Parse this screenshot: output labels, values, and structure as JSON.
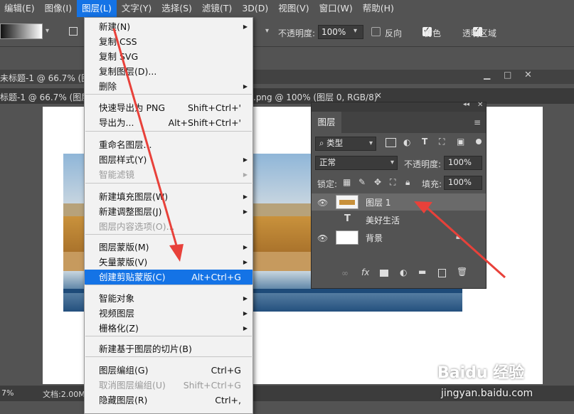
{
  "menubar": {
    "items": [
      "编辑(E)",
      "图像(I)",
      "图层(L)",
      "文字(Y)",
      "选择(S)",
      "滤镜(T)",
      "3D(D)",
      "视图(V)",
      "窗口(W)",
      "帮助(H)"
    ],
    "active_index": 2
  },
  "options_bar": {
    "opacity_label": "不透明度:",
    "opacity_value": "100%",
    "reverse_label": "反向",
    "dither_label": "仿色",
    "transparency_label": "透明区域"
  },
  "documents": {
    "window_title": "未标题-1 @ 66.7% (图层 1, RGB/8)",
    "tab_title": "标题-1 @ 66.7% (图层",
    "tab_second": ".png @ 100% (图层 0, RGB/8)",
    "tab_close": "×"
  },
  "status": {
    "zoom": "7%",
    "doc_info": "文档:2.00M"
  },
  "dropdown": {
    "items": [
      {
        "label": "新建(N)",
        "shortcut": "",
        "submenu": true,
        "disabled": false
      },
      {
        "label": "复制 CSS",
        "shortcut": "",
        "submenu": false,
        "disabled": false
      },
      {
        "label": "复制 SVG",
        "shortcut": "",
        "submenu": false,
        "disabled": false
      },
      {
        "label": "复制图层(D)...",
        "shortcut": "",
        "submenu": false,
        "disabled": false
      },
      {
        "label": "删除",
        "shortcut": "",
        "submenu": true,
        "disabled": false
      },
      {
        "label": "快速导出为 PNG",
        "shortcut": "Shift+Ctrl+'",
        "submenu": false,
        "disabled": false
      },
      {
        "label": "导出为...",
        "shortcut": "Alt+Shift+Ctrl+'",
        "submenu": false,
        "disabled": false
      },
      {
        "label": "重命名图层...",
        "shortcut": "",
        "submenu": false,
        "disabled": false
      },
      {
        "label": "图层样式(Y)",
        "shortcut": "",
        "submenu": true,
        "disabled": false
      },
      {
        "label": "智能滤镜",
        "shortcut": "",
        "submenu": true,
        "disabled": true
      },
      {
        "label": "新建填充图层(W)",
        "shortcut": "",
        "submenu": true,
        "disabled": false
      },
      {
        "label": "新建调整图层(J)",
        "shortcut": "",
        "submenu": true,
        "disabled": false
      },
      {
        "label": "图层内容选项(O)...",
        "shortcut": "",
        "submenu": false,
        "disabled": true
      },
      {
        "label": "图层蒙版(M)",
        "shortcut": "",
        "submenu": true,
        "disabled": false
      },
      {
        "label": "矢量蒙版(V)",
        "shortcut": "",
        "submenu": true,
        "disabled": false
      },
      {
        "label": "创建剪贴蒙版(C)",
        "shortcut": "Alt+Ctrl+G",
        "submenu": false,
        "disabled": false,
        "highlighted": true
      },
      {
        "label": "智能对象",
        "shortcut": "",
        "submenu": true,
        "disabled": false
      },
      {
        "label": "视频图层",
        "shortcut": "",
        "submenu": true,
        "disabled": false
      },
      {
        "label": "栅格化(Z)",
        "shortcut": "",
        "submenu": true,
        "disabled": false
      },
      {
        "label": "新建基于图层的切片(B)",
        "shortcut": "",
        "submenu": false,
        "disabled": false
      },
      {
        "label": "图层编组(G)",
        "shortcut": "Ctrl+G",
        "submenu": false,
        "disabled": false
      },
      {
        "label": "取消图层编组(U)",
        "shortcut": "Shift+Ctrl+G",
        "submenu": false,
        "disabled": true
      },
      {
        "label": "隐藏图层(R)",
        "shortcut": "Ctrl+,",
        "submenu": false,
        "disabled": false
      }
    ]
  },
  "layers_panel": {
    "tab_label": "图层",
    "filter_kind": "类型",
    "blend_mode": "正常",
    "opacity_label": "不透明度:",
    "opacity_value": "100%",
    "lock_label": "锁定:",
    "fill_label": "填充:",
    "fill_value": "100%",
    "layers": [
      {
        "name": "图层 1",
        "type": "image",
        "selected": true
      },
      {
        "name": "美好生活",
        "type": "text",
        "selected": false
      },
      {
        "name": "背景",
        "type": "background",
        "selected": false
      }
    ],
    "footer_icons": [
      "link-icon",
      "fx-icon",
      "mask-icon",
      "adjustment-icon",
      "folder-icon",
      "new-layer-icon",
      "trash-icon"
    ]
  },
  "watermark": {
    "brand": "Baidu 经验",
    "url": "jingyan.baidu.com"
  },
  "colors": {
    "accent": "#1473e6",
    "annotation_arrow": "#e8413a"
  }
}
